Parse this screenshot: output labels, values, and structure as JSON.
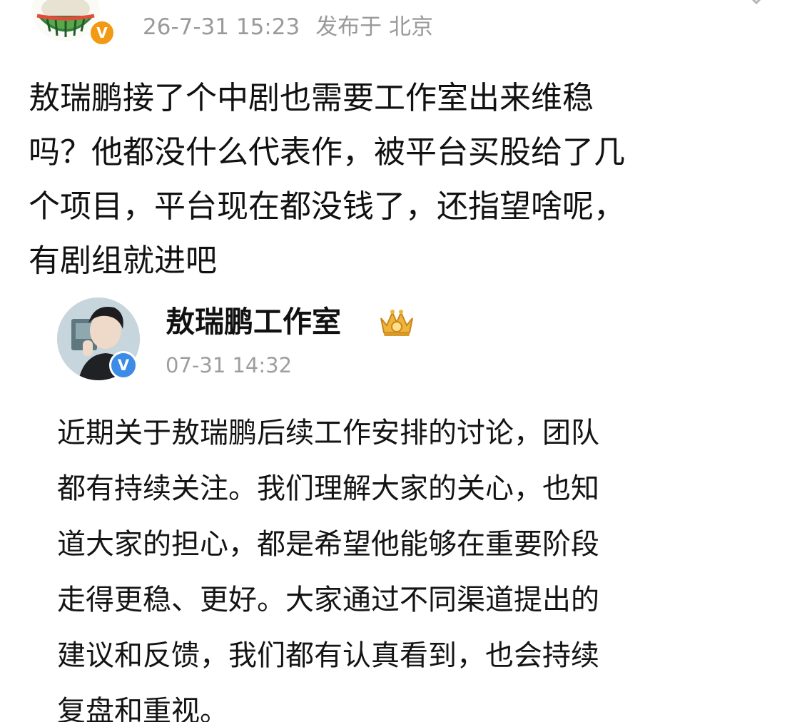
{
  "post": {
    "timestamp": "26-7-31 15:23",
    "location": "发布于 北京",
    "verified_mark": "V",
    "text_lines": [
      "敖瑞鹏接了个中剧也需要工作室出来维稳",
      "吗？他都没什么代表作，被平台买股给了几",
      "个项目，平台现在都没钱了，还指望啥呢，",
      "有剧组就进吧"
    ],
    "avatar_icon": "watermelon-cartoon-icon",
    "verified_color": "#f29a13"
  },
  "quoted_post": {
    "author": "敖瑞鹏工作室",
    "timestamp": "07-31 14:32",
    "verified_mark": "V",
    "verified_color": "#3c8ce7",
    "badge_icon": "crown-badge-icon",
    "text_lines": [
      "近期关于敖瑞鹏后续工作安排的讨论，团队",
      "都有持续关注。我们理解大家的关心，也知",
      "道大家的担心，都是希望他能够在重要阶段",
      "走得更稳、更好。大家通过不同渠道提出的",
      "建议和反馈，我们都有认真看到，也会持续",
      "复盘和重视。"
    ]
  }
}
